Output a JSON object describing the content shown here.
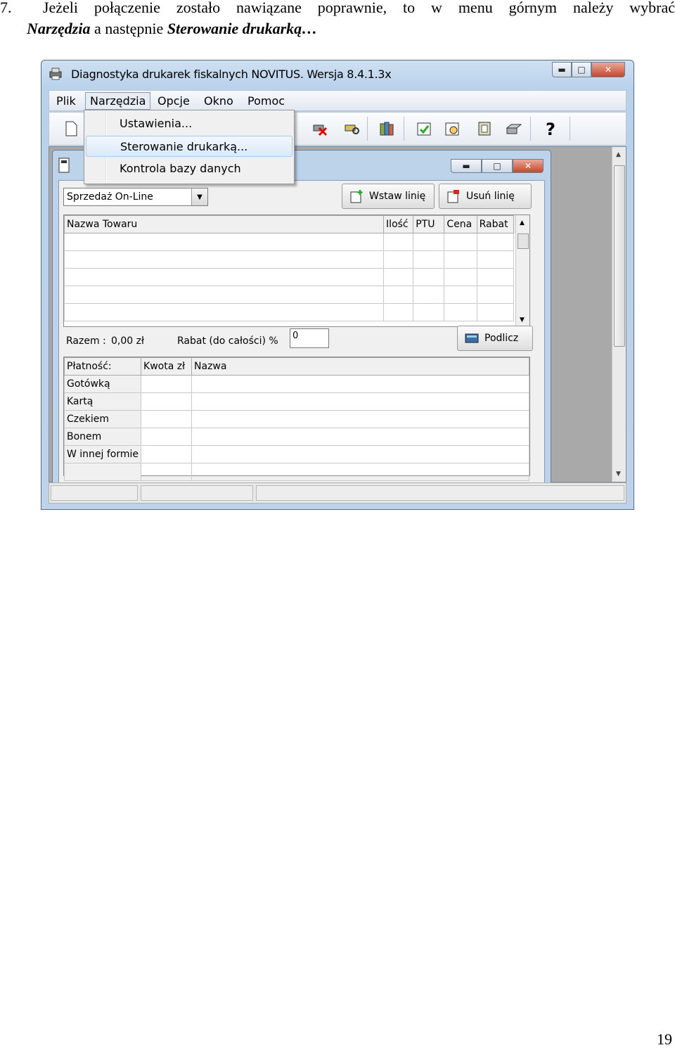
{
  "instruction": {
    "number": "7.",
    "line1_words": [
      "Jeżeli",
      "połączenie",
      "zostało",
      "nawiązane",
      "poprawnie,",
      "to",
      "w",
      "menu",
      "górnym",
      "należy",
      "wybrać"
    ],
    "menu_name": "Narzędzia",
    "connector": " a następnie ",
    "submenu_name": "Sterowanie drukarką…"
  },
  "page_number": "19",
  "window": {
    "title": "Diagnostyka drukarek fiskalnych NOVITUS. Wersja 8.4.1.3x",
    "menu": [
      "Plik",
      "Narzędzia",
      "Opcje",
      "Okno",
      "Pomoc"
    ],
    "active_menu": "Narzędzia",
    "dropdown": [
      "Ustawienia...",
      "Sterowanie drukarką...",
      "Kontrola bazy danych"
    ],
    "dropdown_highlighted": "Sterowanie drukarką..."
  },
  "child": {
    "mode_select": "Sprzedaż On-Line",
    "insert_button": "Wstaw linię",
    "delete_button": "Usuń linię",
    "items_table": {
      "headers": [
        "Nazwa Towaru",
        "Ilość",
        "PTU",
        "Cena",
        "Rabat"
      ],
      "rows": 5
    },
    "total_label": "Razem :",
    "total_value": "0,00 zł",
    "discount_label": "Rabat (do całości) %",
    "discount_value": "0",
    "calc_button": "Podlicz",
    "payment_table": {
      "headers": [
        "Płatność:",
        "Kwota zł",
        "Nazwa"
      ],
      "rows": [
        "Gotówką",
        "Kartą",
        "Czekiem",
        "Bonem",
        "W innej formie"
      ]
    }
  },
  "colors": {
    "titlebar": "#bcd3ea",
    "close_button": "#c8452c",
    "highlight": "#dce9f8"
  }
}
